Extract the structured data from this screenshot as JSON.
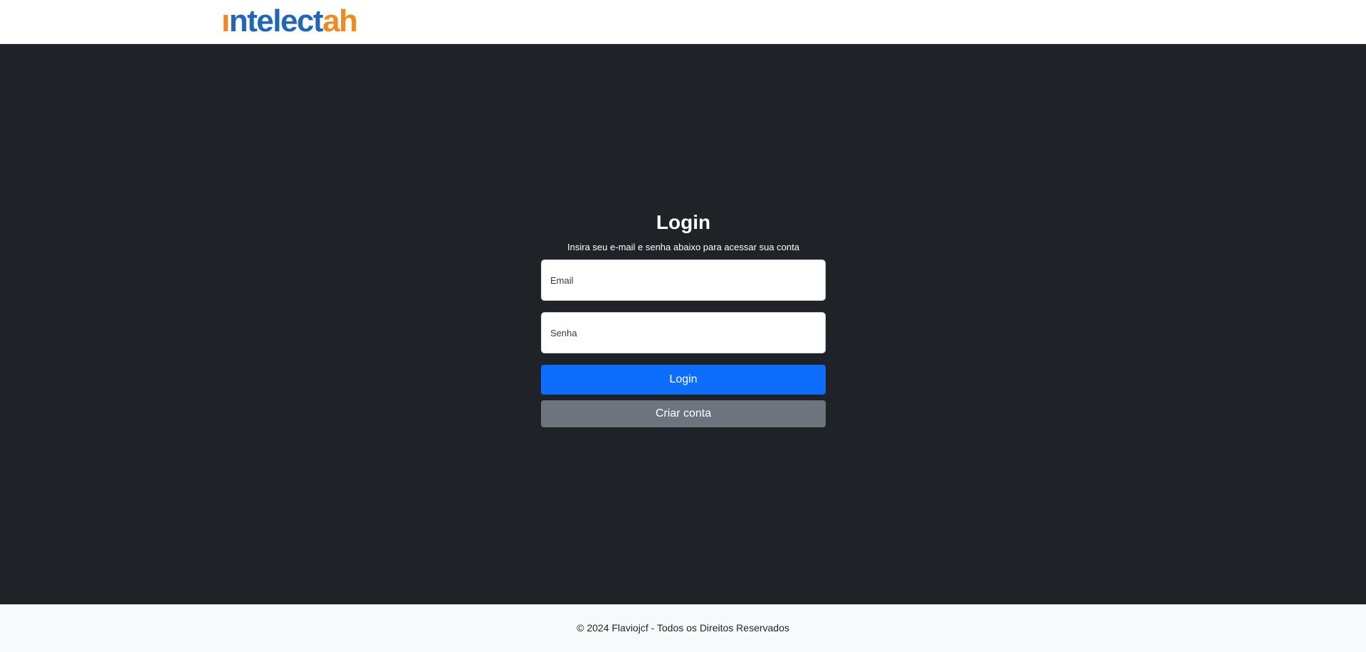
{
  "header": {
    "logo": {
      "i_stem": "ı",
      "part_blue": "ntelect",
      "part_a": "a",
      "part_h": "h"
    }
  },
  "login": {
    "title": "Login",
    "subtitle": "Insira seu e-mail e senha abaixo para acessar sua conta",
    "email_placeholder": "Email",
    "password_placeholder": "Senha",
    "login_button": "Login",
    "create_account_button": "Criar conta"
  },
  "footer": {
    "text": "© 2024 Flaviojcf - Todos os Direitos Reservados"
  },
  "colors": {
    "background": "#1f2328",
    "primary": "#0d6efd",
    "secondary": "#6c757d",
    "logo_blue": "#2166b8",
    "logo_orange": "#f08a1f"
  }
}
